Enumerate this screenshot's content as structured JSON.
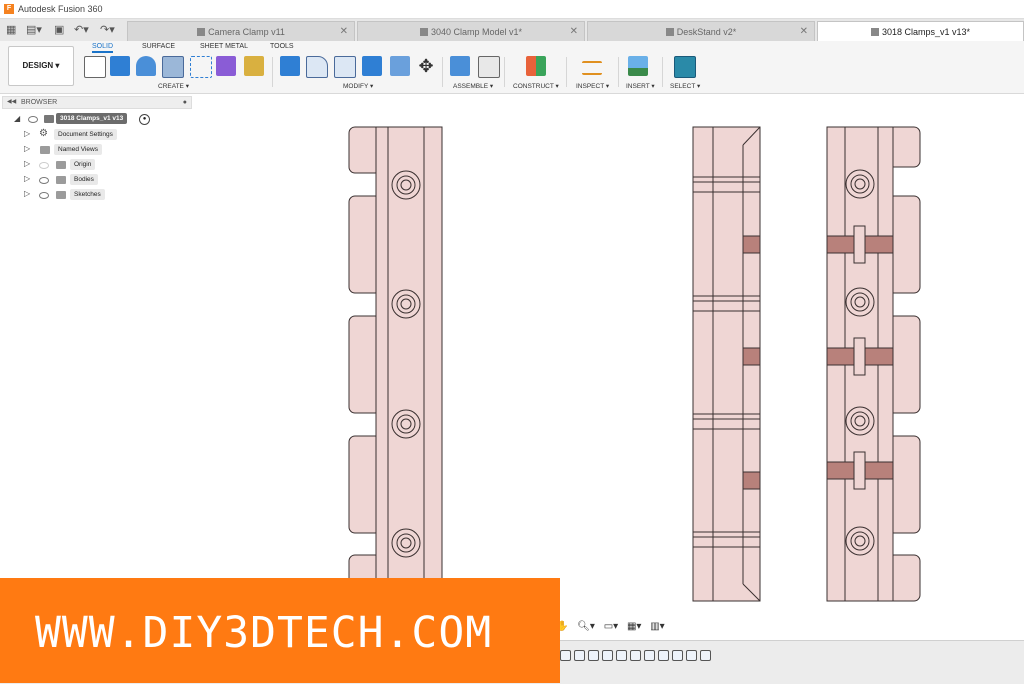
{
  "app": {
    "title": "Autodesk Fusion 360",
    "logo_letter": "F"
  },
  "doc_tabs": [
    {
      "label": "Camera Clamp v11",
      "active": false
    },
    {
      "label": "3040 Clamp Model v1*",
      "active": false
    },
    {
      "label": "DeskStand v2*",
      "active": false
    },
    {
      "label": "3018 Clamps_v1 v13*",
      "active": true
    }
  ],
  "toolbar": {
    "workspace": "DESIGN ▾",
    "tabs": [
      "SOLID",
      "SURFACE",
      "SHEET METAL",
      "TOOLS"
    ],
    "groups": [
      "CREATE ▾",
      "MODIFY ▾",
      "ASSEMBLE ▾",
      "CONSTRUCT ▾",
      "INSPECT ▾",
      "INSERT ▾",
      "SELECT ▾"
    ]
  },
  "browser": {
    "title": "BROWSER",
    "root": "3018 Clamps_v1 v13",
    "items": [
      "Document Settings",
      "Named Views",
      "Origin",
      "Bodies",
      "Sketches"
    ]
  },
  "colors": {
    "accent": "#1a73c8",
    "body_fill": "#efd6d4",
    "body_stroke": "#3a3030",
    "clamp_fill": "#b8817b",
    "banner": "#ff7a12"
  },
  "banner": {
    "text": "WWW.DIY3DTECH.COM"
  }
}
